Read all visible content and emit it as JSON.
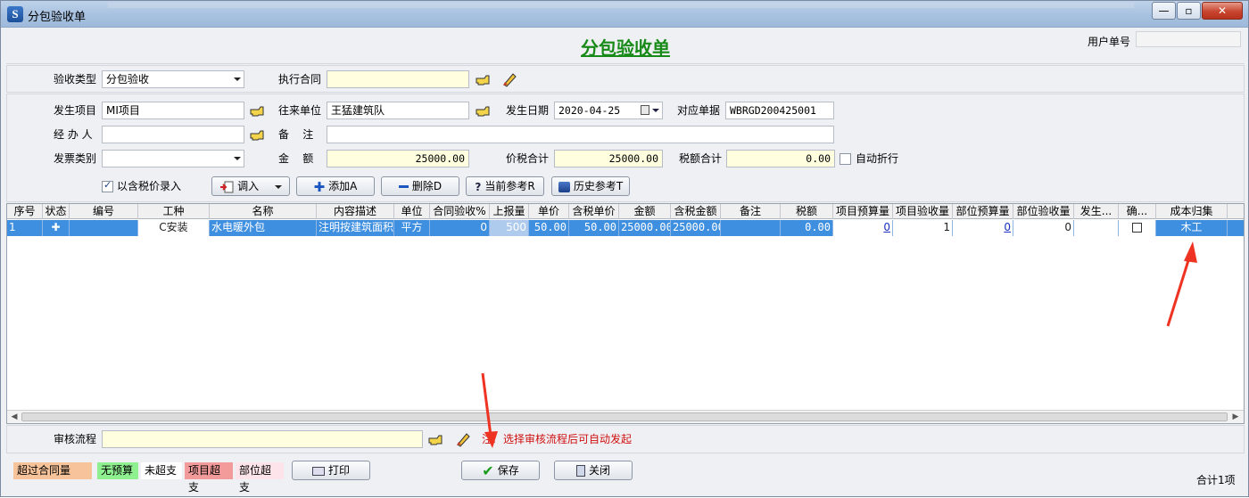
{
  "window": {
    "title": "分包验收单",
    "buttons": [
      "—",
      "▫",
      "✕"
    ]
  },
  "header": {
    "title": "分包验收单",
    "user_doc_label": "用户单号",
    "user_doc_value": ""
  },
  "row1": {
    "acceptance_type_label": "验收类型",
    "acceptance_type_value": "分包验收",
    "contract_label": "执行合同",
    "contract_value": ""
  },
  "form": {
    "project_label": "发生项目",
    "project_value": "MI项目",
    "partner_label": "往来单位",
    "partner_value": "王猛建筑队",
    "date_label": "发生日期",
    "date_value": "2020-04-25",
    "ref_doc_label": "对应单据",
    "ref_doc_value": "WBRGD200425001",
    "handler_label": "经 办 人",
    "handler_value": "",
    "remark_label": "备    注",
    "remark_value": "",
    "invoice_label": "发票类别",
    "invoice_value": "",
    "amount_label": "金    额",
    "amount_value": "25000.00",
    "tax_total_label": "价税合计",
    "tax_total_value": "25000.00",
    "tax_label": "税额合计",
    "tax_value": "0.00",
    "auto_discount_label": "自动折行",
    "tax_inclusive_label": "以含税价录入"
  },
  "toolbar": {
    "import_label": "调入",
    "add_label": "添加A",
    "delete_label": "删除D",
    "current_ref_label": "当前参考R",
    "history_ref_label": "历史参考T"
  },
  "grid": {
    "columns": [
      "序号",
      "状态",
      "编号",
      "工种",
      "名称",
      "内容描述",
      "单位",
      "合同验收%",
      "上报量",
      "单价",
      "含税单价",
      "金额",
      "含税金额",
      "备注",
      "税额",
      "项目预算量",
      "项目验收量",
      "部位预算量",
      "部位验收量",
      "发生...",
      "确...",
      "成本归集"
    ],
    "row": {
      "seq": "1",
      "status": "✚",
      "code": "",
      "work_type": "C安装",
      "name": "水电暖外包",
      "desc": "注明按建筑面积",
      "unit": "平方",
      "contract_pct": "0",
      "reported": "500",
      "price": "50.00",
      "tax_price": "50.00",
      "amount": "25000.00",
      "tax_amount": "25000.00",
      "remark": "",
      "tax": "0.00",
      "proj_budget": "0",
      "proj_accept": "1",
      "part_budget": "0",
      "part_accept": "0",
      "occur": "",
      "cost_collect": "木工"
    }
  },
  "approval": {
    "label": "审核流程",
    "value": "",
    "note_prefix": "注:",
    "note": "选择审核流程后可自动发起"
  },
  "legend": [
    {
      "label": "超过合同量",
      "color": "#f7c39a"
    },
    {
      "label": "无预算",
      "color": "#8ff08f"
    },
    {
      "label": "未超支",
      "color": "#ffffff"
    },
    {
      "label": "项目超支",
      "color": "#f39b9b"
    },
    {
      "label": "部位超支",
      "color": "#fde4ea"
    }
  ],
  "footer": {
    "print_label": "打印",
    "save_label": "保存",
    "close_label": "关闭",
    "total_text": "合计1项"
  },
  "colors": {
    "title_green": "#188a18",
    "row_highlight": "#3f8fe0",
    "note_red": "#d01010",
    "arrow_red": "#ee3322"
  }
}
